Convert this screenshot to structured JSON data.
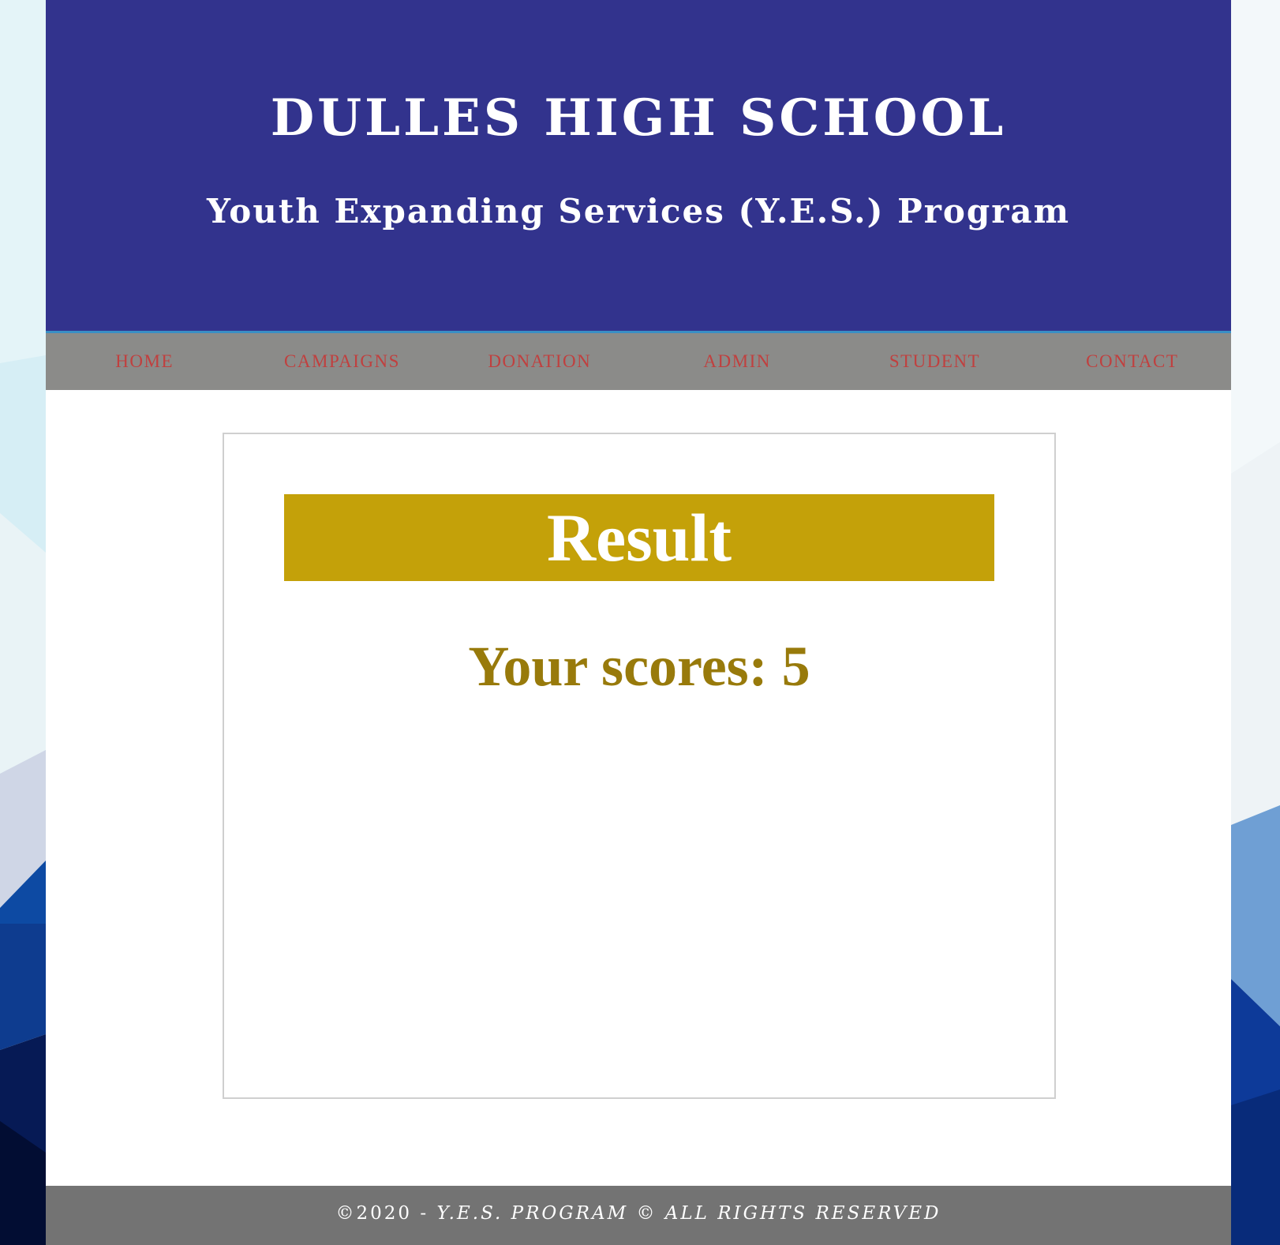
{
  "header": {
    "title": "DULLES HIGH SCHOOL",
    "subtitle": "Youth Expanding Services (Y.E.S.) Program"
  },
  "nav": {
    "items": [
      {
        "label": "HOME"
      },
      {
        "label": "CAMPAIGNS"
      },
      {
        "label": "DONATION"
      },
      {
        "label": "ADMIN"
      },
      {
        "label": "STUDENT"
      },
      {
        "label": "CONTACT"
      }
    ]
  },
  "result": {
    "title": "Result",
    "score_text": "Your scores: 5"
  },
  "footer": {
    "year": "©2020 - ",
    "text": "Y.E.S. PROGRAM © ALL RIGHTS RESERVED"
  },
  "colors": {
    "header_bg": "#32338d",
    "nav_bg": "#8b8b89",
    "nav_text": "#c0403f",
    "result_banner": "#c4a109",
    "score_text": "#987a0b",
    "footer_bg": "#737373"
  }
}
